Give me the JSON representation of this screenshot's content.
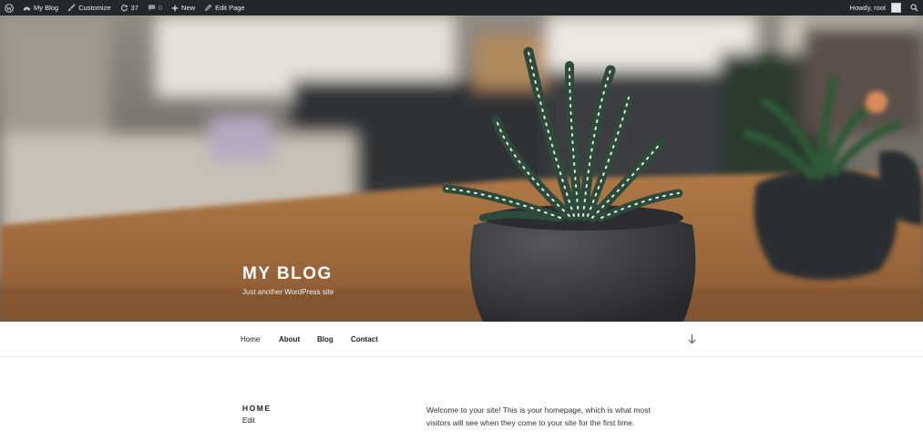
{
  "adminbar": {
    "wp_logo_icon": "wordpress-icon",
    "site_name": "My Blog",
    "customize": "Customize",
    "updates_count": "37",
    "comments_count": "0",
    "new_label": "New",
    "edit_page": "Edit Page",
    "howdy": "Howdy, root"
  },
  "header": {
    "title": "MY BLOG",
    "description": "Just another WordPress site"
  },
  "nav": {
    "items": [
      "Home",
      "About",
      "Blog",
      "Contact"
    ]
  },
  "page": {
    "title": "HOME",
    "edit": "Edit",
    "content": "Welcome to your site! This is your homepage, which is what most visitors will see when they come to your site for the first time."
  }
}
